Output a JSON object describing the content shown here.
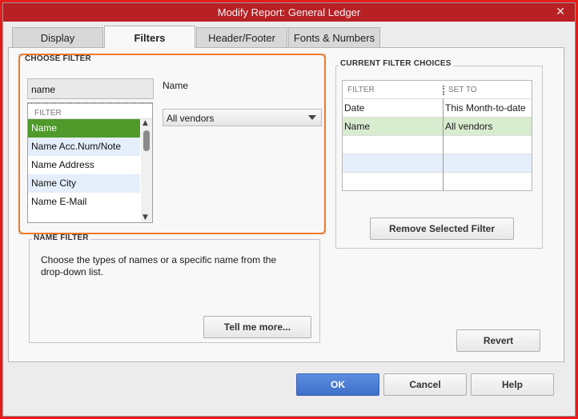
{
  "window": {
    "title": "Modify Report: General Ledger",
    "close_glyph": "✕"
  },
  "tabs": [
    {
      "label": "Display"
    },
    {
      "label": "Filters"
    },
    {
      "label": "Header/Footer"
    },
    {
      "label": "Fonts & Numbers"
    }
  ],
  "choose_filter": {
    "label": "CHOOSE FILTER",
    "search_value": "name",
    "list_header": "FILTER",
    "items": [
      "Name",
      "Name Acc.Num/Note",
      "Name Address",
      "Name City",
      "Name E-Mail"
    ],
    "selected_index": 0,
    "field_label": "Name",
    "dropdown_value": "All vendors"
  },
  "name_filter": {
    "label": "NAME FILTER",
    "description": "Choose the types of names or a specific name from the drop-down list.",
    "tell_me_more_label": "Tell me more..."
  },
  "current_filters": {
    "label": "CURRENT FILTER CHOICES",
    "col_filter": "FILTER",
    "col_set_to": "SET TO",
    "rows": [
      {
        "filter": "Date",
        "set_to": "This Month-to-date"
      },
      {
        "filter": "Name",
        "set_to": "All vendors"
      }
    ],
    "remove_label": "Remove Selected Filter",
    "revert_label": "Revert"
  },
  "footer": {
    "ok_label": "OK",
    "cancel_label": "Cancel",
    "help_label": "Help"
  },
  "colors": {
    "highlight_border": "#f07a2a",
    "selected_item": "#4f9a2a",
    "primary_button": "#3f6fc8",
    "titlebar": "#b82024"
  }
}
